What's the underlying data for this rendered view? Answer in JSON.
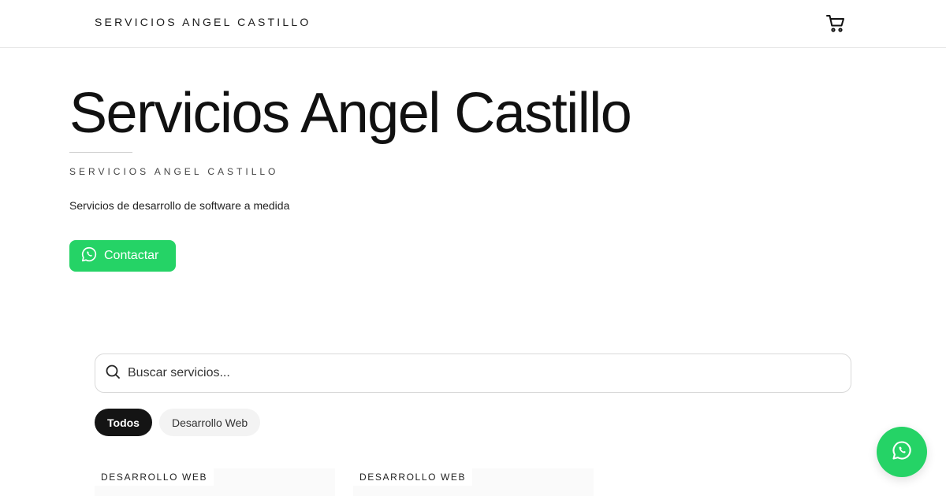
{
  "header": {
    "brand": "SERVICIOS ANGEL CASTILLO",
    "cart_icon": "cart-icon"
  },
  "hero": {
    "title": "Servicios Angel Castillo",
    "subtitle": "SERVICIOS ANGEL CASTILLO",
    "description": "Servicios de desarrollo de software a medida",
    "contact_label": "Contactar",
    "contact_icon": "whatsapp-icon"
  },
  "search": {
    "placeholder": "Buscar servicios...",
    "value": "",
    "icon": "search-icon"
  },
  "filters": [
    {
      "label": "Todos",
      "active": true
    },
    {
      "label": "Desarrollo Web",
      "active": false
    }
  ],
  "cards": [
    {
      "category": "DESARROLLO WEB"
    },
    {
      "category": "DESARROLLO WEB"
    }
  ],
  "floating": {
    "icon": "whatsapp-icon"
  },
  "colors": {
    "whatsapp_green": "#25d366",
    "chip_active_bg": "#141414",
    "chip_inactive_bg": "#f3f3f3",
    "text": "#111111"
  }
}
